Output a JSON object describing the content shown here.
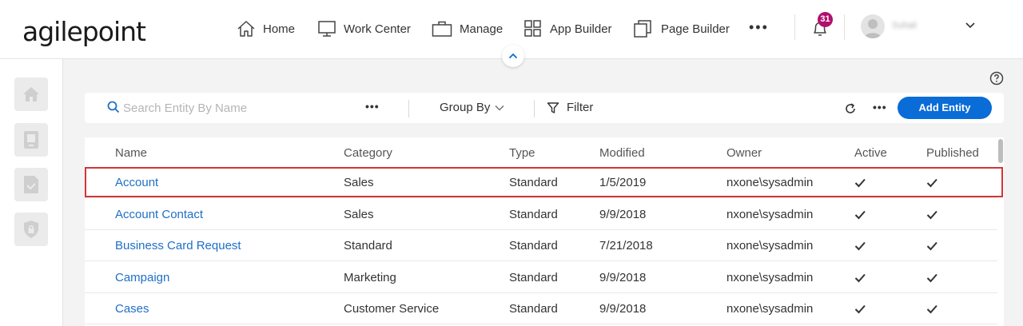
{
  "app": {
    "logo_text": "agilepoint",
    "nav": [
      {
        "label": "Home",
        "icon": "home-icon"
      },
      {
        "label": "Work Center",
        "icon": "monitor-icon"
      },
      {
        "label": "Manage",
        "icon": "briefcase-icon"
      },
      {
        "label": "App Builder",
        "icon": "grid-icon"
      },
      {
        "label": "Page Builder",
        "icon": "copy-icon"
      }
    ],
    "more_label": "•••",
    "notification_count": "31",
    "user_name": "Suhail",
    "colors": {
      "accent": "#0a6cd6",
      "badge": "#b0106d",
      "link": "#1f6fc7",
      "highlight": "#d23636"
    }
  },
  "sidebar": {
    "items": [
      {
        "icon": "home-icon"
      },
      {
        "icon": "tablet-icon"
      },
      {
        "icon": "document-check-icon"
      },
      {
        "icon": "shield-lock-icon"
      }
    ]
  },
  "toolbar": {
    "search_placeholder": "Search Entity By Name",
    "more_label": "•••",
    "group_by_label": "Group By",
    "filter_label": "Filter",
    "add_button_label": "Add Entity"
  },
  "table": {
    "columns": [
      "Name",
      "Category",
      "Type",
      "Modified",
      "Owner",
      "Active",
      "Published"
    ],
    "rows": [
      {
        "name": "Account",
        "category": "Sales",
        "type": "Standard",
        "modified": "1/5/2019",
        "owner": "nxone\\sysadmin",
        "active": true,
        "published": true
      },
      {
        "name": "Account Contact",
        "category": "Sales",
        "type": "Standard",
        "modified": "9/9/2018",
        "owner": "nxone\\sysadmin",
        "active": true,
        "published": true
      },
      {
        "name": "Business Card Request",
        "category": "Standard",
        "type": "Standard",
        "modified": "7/21/2018",
        "owner": "nxone\\sysadmin",
        "active": true,
        "published": true
      },
      {
        "name": "Campaign",
        "category": "Marketing",
        "type": "Standard",
        "modified": "9/9/2018",
        "owner": "nxone\\sysadmin",
        "active": true,
        "published": true
      },
      {
        "name": "Cases",
        "category": "Customer Service",
        "type": "Standard",
        "modified": "9/9/2018",
        "owner": "nxone\\sysadmin",
        "active": true,
        "published": true
      }
    ]
  }
}
